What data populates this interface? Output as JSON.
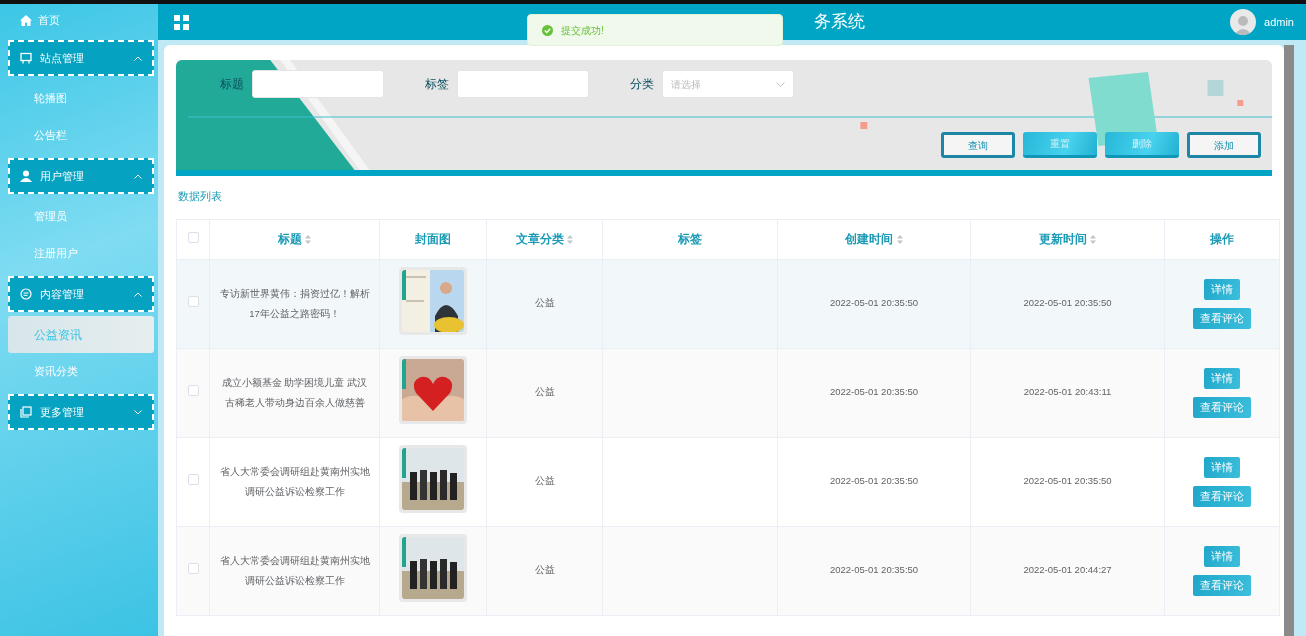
{
  "header": {
    "title": "务系统",
    "user": "admin"
  },
  "toast": {
    "message": "提交成功!"
  },
  "sidebar": {
    "items": [
      {
        "label": "首页",
        "kind": "link"
      },
      {
        "label": "站点管理",
        "kind": "group",
        "expanded": true,
        "children": [
          {
            "label": "轮播图",
            "selected": false
          },
          {
            "label": "公告栏",
            "selected": false
          }
        ]
      },
      {
        "label": "用户管理",
        "kind": "group",
        "expanded": true,
        "children": [
          {
            "label": "管理员",
            "selected": false
          },
          {
            "label": "注册用户",
            "selected": false
          }
        ]
      },
      {
        "label": "内容管理",
        "kind": "group",
        "expanded": true,
        "children": [
          {
            "label": "公益资讯",
            "selected": true
          },
          {
            "label": "资讯分类",
            "selected": false
          }
        ]
      },
      {
        "label": "更多管理",
        "kind": "group",
        "expanded": false
      }
    ]
  },
  "search": {
    "fields": [
      {
        "label": "标题",
        "kind": "input"
      },
      {
        "label": "标签",
        "kind": "input"
      },
      {
        "label": "分类",
        "kind": "select",
        "placeholder": "请选择"
      }
    ],
    "buttons": [
      {
        "label": "查询",
        "kind": "outline"
      },
      {
        "label": "重置",
        "kind": "solid"
      },
      {
        "label": "删除",
        "kind": "solid"
      },
      {
        "label": "添加",
        "kind": "outline"
      }
    ]
  },
  "table": {
    "caption": "数据列表",
    "select_all_checked": false,
    "columns": [
      {
        "label": "标题",
        "sortable": true
      },
      {
        "label": "封面图",
        "sortable": false
      },
      {
        "label": "文章分类",
        "sortable": true
      },
      {
        "label": "标签",
        "sortable": false
      },
      {
        "label": "创建时间",
        "sortable": true
      },
      {
        "label": "更新时间",
        "sortable": true
      },
      {
        "label": "操作",
        "sortable": false
      }
    ],
    "rows": [
      {
        "checked": false,
        "title": "专访新世界黄伟：捐资过亿！解析17年公益之路密码！",
        "category": "公益",
        "created": "2022-05-01 20:35:50",
        "updated": "2022-05-01 20:35:50",
        "actions": [
          "详情",
          "查看评论"
        ]
      },
      {
        "checked": false,
        "title": "成立小额基金 助学困境儿童 武汉古稀老人带动身边百余人做慈善",
        "category": "公益",
        "created": "2022-05-01 20:35:50",
        "updated": "2022-05-01 20:43:11",
        "actions": [
          "详情",
          "查看评论"
        ]
      },
      {
        "checked": false,
        "title": "省人大常委会调研组赴黄南州实地调研公益诉讼检察工作",
        "category": "公益",
        "created": "2022-05-01 20:35:50",
        "updated": "2022-05-01 20:35:50",
        "actions": [
          "详情",
          "查看评论"
        ]
      },
      {
        "checked": false,
        "title": "省人大常委会调研组赴黄南州实地调研公益诉讼检察工作",
        "category": "公益",
        "created": "2022-05-01 20:35:50",
        "updated": "2022-05-01 20:44:27",
        "actions": [
          "详情",
          "查看评论"
        ]
      }
    ]
  }
}
